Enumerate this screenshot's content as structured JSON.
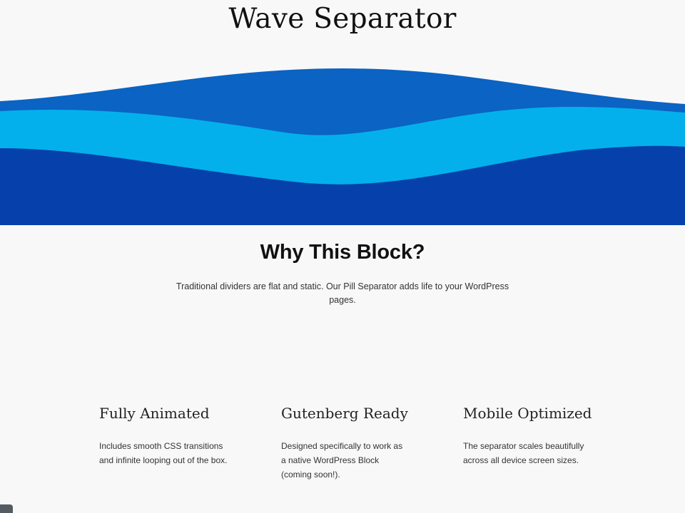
{
  "header": {
    "title": "Wave Separator"
  },
  "wave": {
    "colors": {
      "back": "#0b63c3",
      "middle": "#04b0ec",
      "front": "#0641ab"
    }
  },
  "why": {
    "heading": "Why This Block?",
    "text": "Traditional dividers are flat and static. Our Pill Separator adds life to your WordPress pages."
  },
  "features": [
    {
      "title": "Fully Animated",
      "text": "Includes smooth CSS transitions and infinite looping out of the box."
    },
    {
      "title": "Gutenberg Ready",
      "text": "Designed specifically to work as a native WordPress Block (coming soon!)."
    },
    {
      "title": "Mobile Optimized",
      "text": "The separator scales beautifully across all device screen sizes."
    }
  ]
}
